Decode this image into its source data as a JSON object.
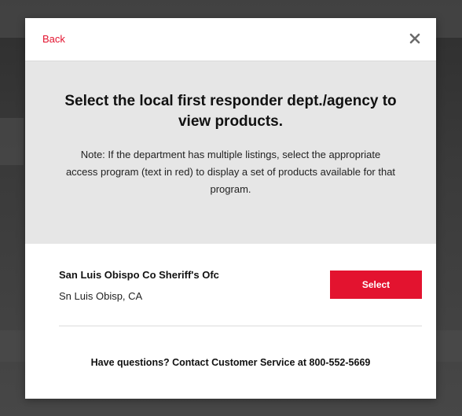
{
  "modal": {
    "back_label": "Back",
    "close_icon": "close-icon",
    "title": "Select the local first responder dept./agency to view products.",
    "note": "Note: If the department has multiple listings, select the appropriate access program (text in red) to display a set of products available for that program.",
    "listings": [
      {
        "name": "San Luis Obispo Co Sheriff's Ofc",
        "location": "Sn Luis Obisp, CA",
        "button_label": "Select"
      }
    ],
    "help": "Have questions? Contact Customer Service at 800-552-5669"
  },
  "colors": {
    "accent": "#e3132f",
    "intro_background": "#e6e6e6",
    "overlay": "#3d3d3d"
  }
}
